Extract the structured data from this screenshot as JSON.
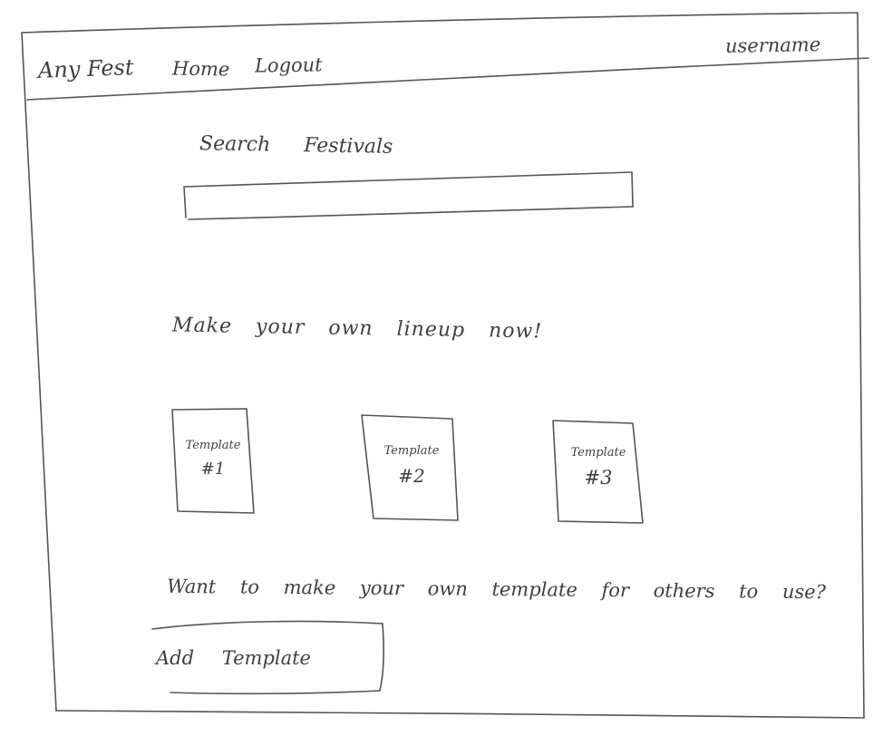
{
  "nav": {
    "brand": "Any Fest",
    "home": "Home",
    "logout": "Logout",
    "username": "username"
  },
  "search": {
    "heading": "Search Festivals",
    "value": ""
  },
  "promo": {
    "text": "Make your own lineup now!"
  },
  "templates": [
    {
      "label": "Template",
      "number": "#1"
    },
    {
      "label": "Template",
      "number": "#2"
    },
    {
      "label": "Template",
      "number": "#3"
    }
  ],
  "contribute": {
    "text": "Want to make your own template for others to use?",
    "button_label": "Add Template"
  }
}
